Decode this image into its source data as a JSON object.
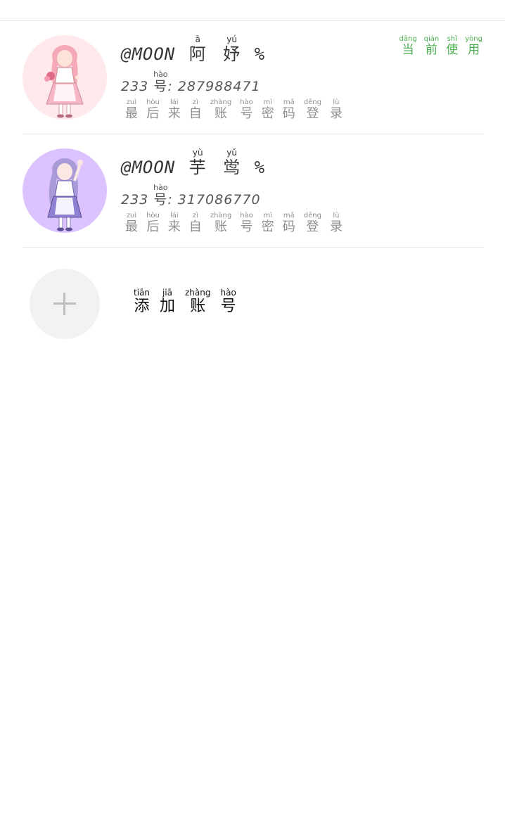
{
  "accounts": [
    {
      "handle": "@MOON",
      "name_chars": [
        {
          "char": "阿",
          "pinyin": "ā"
        },
        {
          "char": "妤",
          "pinyin": "yú"
        }
      ],
      "name_suffix": "%",
      "uid_prefix": "233",
      "uid_char": {
        "char": "号",
        "pinyin": "hào"
      },
      "uid_value": ": 287988471",
      "last_login_chars": [
        {
          "char": "最",
          "pinyin": "zuì"
        },
        {
          "char": "后",
          "pinyin": "hòu"
        },
        {
          "char": "来",
          "pinyin": "lái"
        },
        {
          "char": "自",
          "pinyin": "zì"
        },
        {
          "char": "账",
          "pinyin": "zhàng"
        },
        {
          "char": "号",
          "pinyin": "hào"
        },
        {
          "char": "密",
          "pinyin": "mì"
        },
        {
          "char": "码",
          "pinyin": "mǎ"
        },
        {
          "char": "登",
          "pinyin": "dēng"
        },
        {
          "char": "录",
          "pinyin": "lù"
        }
      ],
      "current_chars": [
        {
          "char": "当",
          "pinyin": "dāng"
        },
        {
          "char": "前",
          "pinyin": "qián"
        },
        {
          "char": "使",
          "pinyin": "shǐ"
        },
        {
          "char": "用",
          "pinyin": "yòng"
        }
      ],
      "avatar_icon": "pink-maid-girl-avatar",
      "avatar_bg": "#ffe9ec"
    },
    {
      "handle": "@MOON",
      "name_chars": [
        {
          "char": "芋",
          "pinyin": "yù"
        },
        {
          "char": "鸴",
          "pinyin": "yǔ"
        }
      ],
      "name_suffix": "%",
      "uid_prefix": "233",
      "uid_char": {
        "char": "号",
        "pinyin": "hào"
      },
      "uid_value": ": 317086770",
      "last_login_chars": [
        {
          "char": "最",
          "pinyin": "zuì"
        },
        {
          "char": "后",
          "pinyin": "hòu"
        },
        {
          "char": "来",
          "pinyin": "lái"
        },
        {
          "char": "自",
          "pinyin": "zì"
        },
        {
          "char": "账",
          "pinyin": "zhàng"
        },
        {
          "char": "号",
          "pinyin": "hào"
        },
        {
          "char": "密",
          "pinyin": "mì"
        },
        {
          "char": "码",
          "pinyin": "mǎ"
        },
        {
          "char": "登",
          "pinyin": "dēng"
        },
        {
          "char": "录",
          "pinyin": "lù"
        }
      ],
      "avatar_icon": "purple-maid-girl-avatar",
      "avatar_bg": "#dcc3ff"
    }
  ],
  "add_account": {
    "icon": "plus-icon",
    "chars": [
      {
        "char": "添",
        "pinyin": "tiān"
      },
      {
        "char": "加",
        "pinyin": "jiā"
      },
      {
        "char": "账",
        "pinyin": "zhàng"
      },
      {
        "char": "号",
        "pinyin": "hào"
      }
    ]
  },
  "colors": {
    "current_accent": "#4caf50",
    "divider": "#ececec",
    "muted_text": "#8f8f8f"
  }
}
